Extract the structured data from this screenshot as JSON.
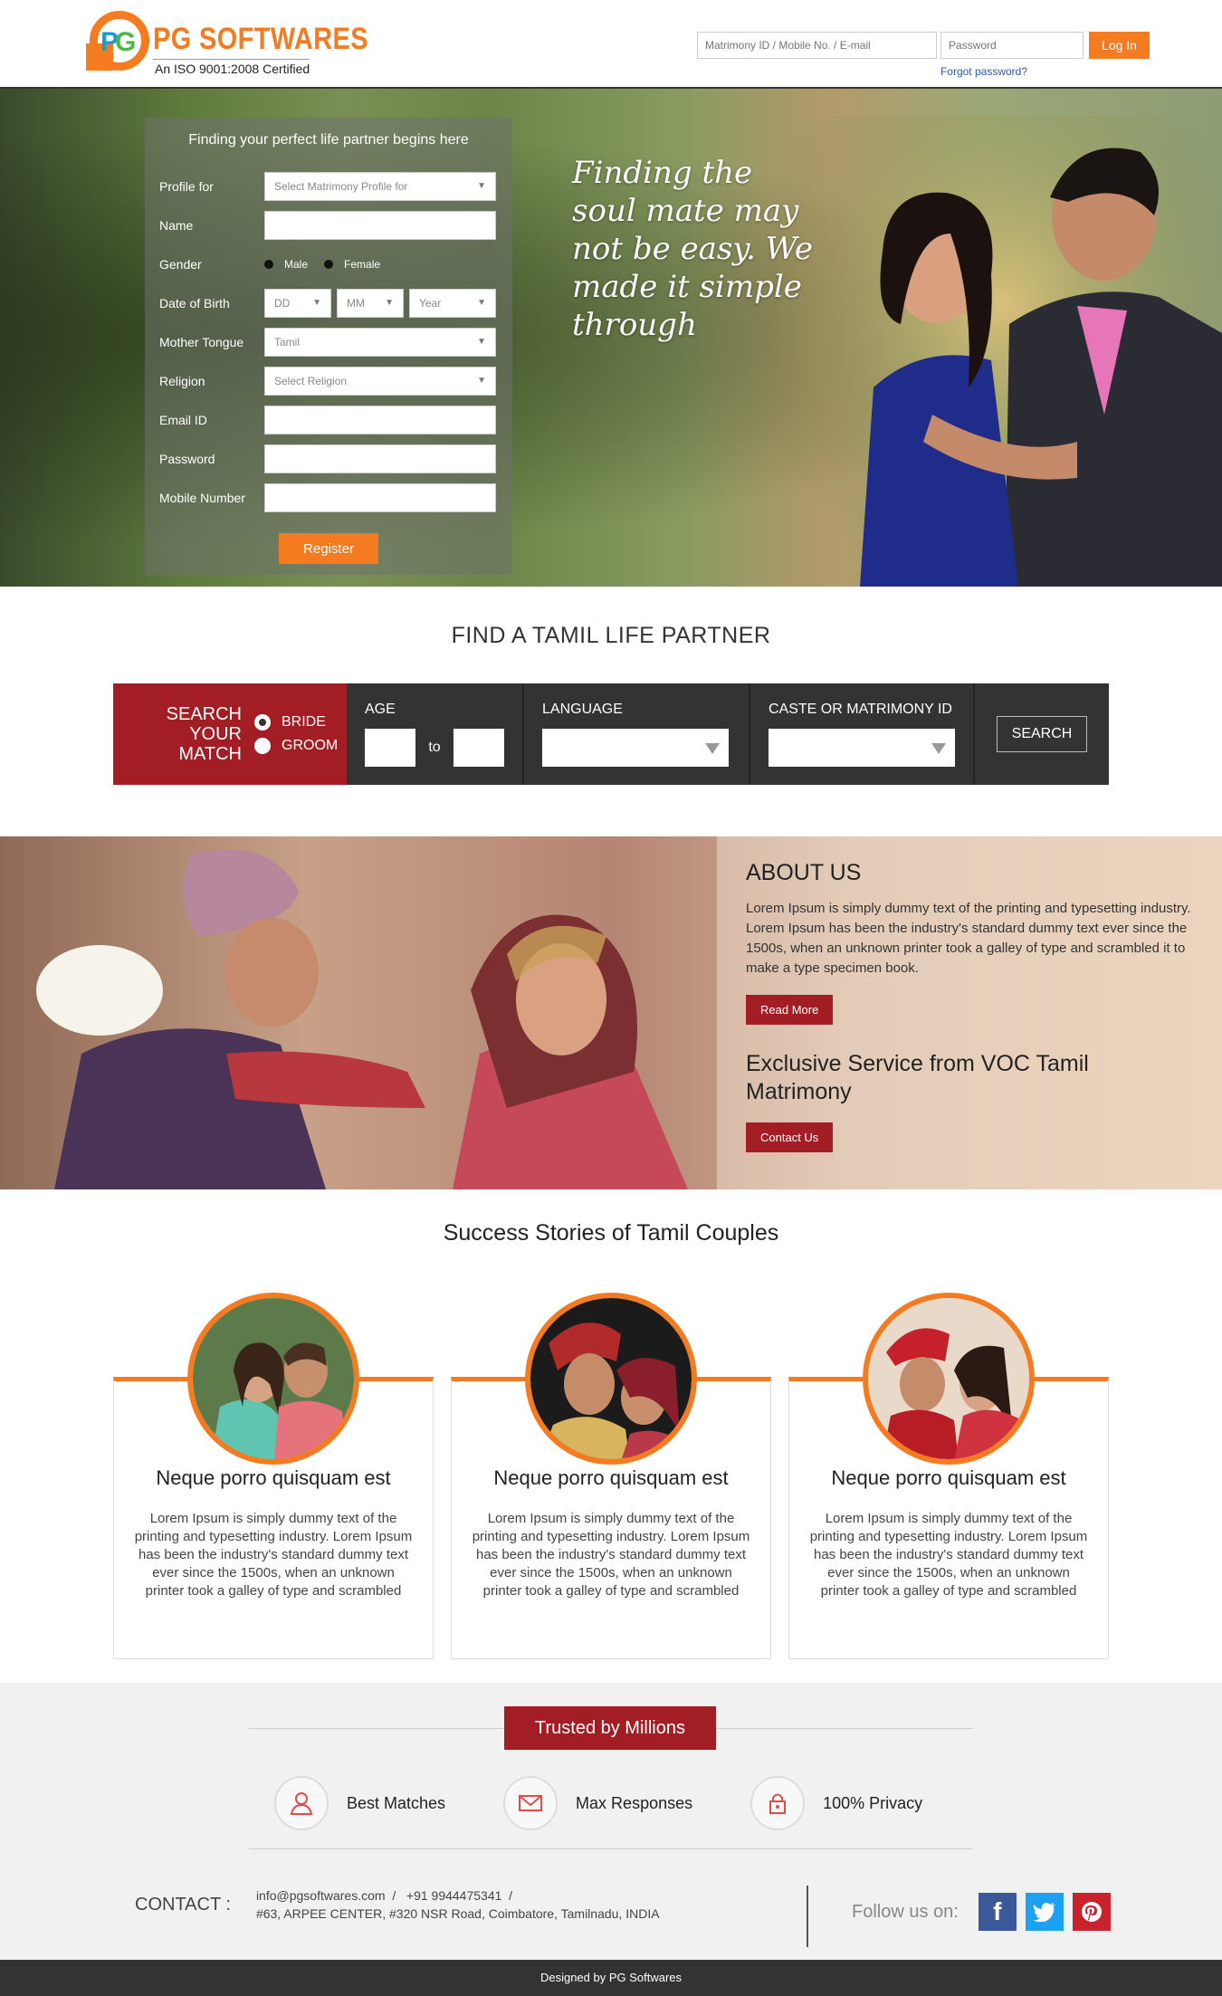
{
  "brand": {
    "name": "PG SOFTWARES",
    "tagline": "An ISO 9001:2008 Certified"
  },
  "login": {
    "id_placeholder": "Matrimony ID / Mobile No. / E-mail",
    "password_placeholder": "Password",
    "button": "Log In",
    "forgot": "Forgot password?"
  },
  "register": {
    "heading": "Finding your perfect life partner begins here",
    "labels": {
      "profile_for": "Profile for",
      "name": "Name",
      "gender": "Gender",
      "dob": "Date of Birth",
      "mother_tongue": "Mother Tongue",
      "religion": "Religion",
      "email": "Email ID",
      "password": "Password",
      "mobile": "Mobile Number"
    },
    "profile_for_value": "Select Matrimony Profile for",
    "gender_options": [
      "Male",
      "Female"
    ],
    "dob": {
      "day": "DD",
      "month": "MM",
      "year": "Year"
    },
    "mother_tongue_value": "Tamil",
    "religion_value": "Select Religion",
    "button": "Register"
  },
  "hero": {
    "tagline": "Finding the soul mate may not be easy. We made it simple through"
  },
  "find": {
    "title": "FIND A TAMIL LIFE PARTNER",
    "search_label": "SEARCH YOUR MATCH",
    "options": [
      "BRIDE",
      "GROOM"
    ],
    "age_label": "AGE",
    "age_to": "to",
    "language_label": "LANGUAGE",
    "caste_label": "CASTE OR MATRIMONY ID",
    "search_button": "SEARCH"
  },
  "about": {
    "title": "ABOUT US",
    "text": "Lorem Ipsum is simply dummy text of the printing and typesetting industry. Lorem Ipsum has been the industry's standard dummy text ever since the 1500s, when an unknown printer took a galley of type and scrambled it to make a type specimen book.",
    "read_more": "Read More",
    "service_title": "Exclusive Service from VOC Tamil Matrimony",
    "contact_button": "Contact Us"
  },
  "stories": {
    "title": "Success Stories of Tamil Couples",
    "items": [
      {
        "title": "Neque porro quisquam est",
        "text": "Lorem Ipsum is simply dummy text of the printing and typesetting industry. Lorem Ipsum has been the industry's standard dummy text ever since the 1500s, when an unknown printer took a galley of type and scrambled"
      },
      {
        "title": "Neque porro quisquam est",
        "text": "Lorem Ipsum is simply dummy text of the printing and typesetting industry. Lorem Ipsum has been the industry's standard dummy text ever since the 1500s, when an unknown printer took a galley of type and scrambled"
      },
      {
        "title": "Neque porro quisquam est",
        "text": "Lorem Ipsum is simply dummy text of the printing and typesetting industry. Lorem Ipsum has been the industry's standard dummy text ever since the 1500s, when an unknown printer took a galley of type and scrambled"
      }
    ]
  },
  "trust": {
    "badge": "Trusted by Millions",
    "features": [
      {
        "label": "Best Matches",
        "icon": "user-icon"
      },
      {
        "label": "Max Responses",
        "icon": "envelope-icon"
      },
      {
        "label": "100% Privacy",
        "icon": "lock-icon"
      }
    ]
  },
  "contact": {
    "label": "CONTACT :",
    "email": "info@pgsoftwares.com",
    "phone": "+91 9944475341",
    "address": "#63, ARPEE CENTER, #320 NSR Road, Coimbatore, Tamilnadu, INDIA",
    "follow": "Follow us on:",
    "social": [
      "facebook-icon",
      "twitter-icon",
      "pinterest-icon"
    ]
  },
  "footer": {
    "text": "Designed by PG Softwares"
  },
  "colors": {
    "orange": "#f47b20",
    "maroon": "#a31d24",
    "dark": "#333333"
  }
}
